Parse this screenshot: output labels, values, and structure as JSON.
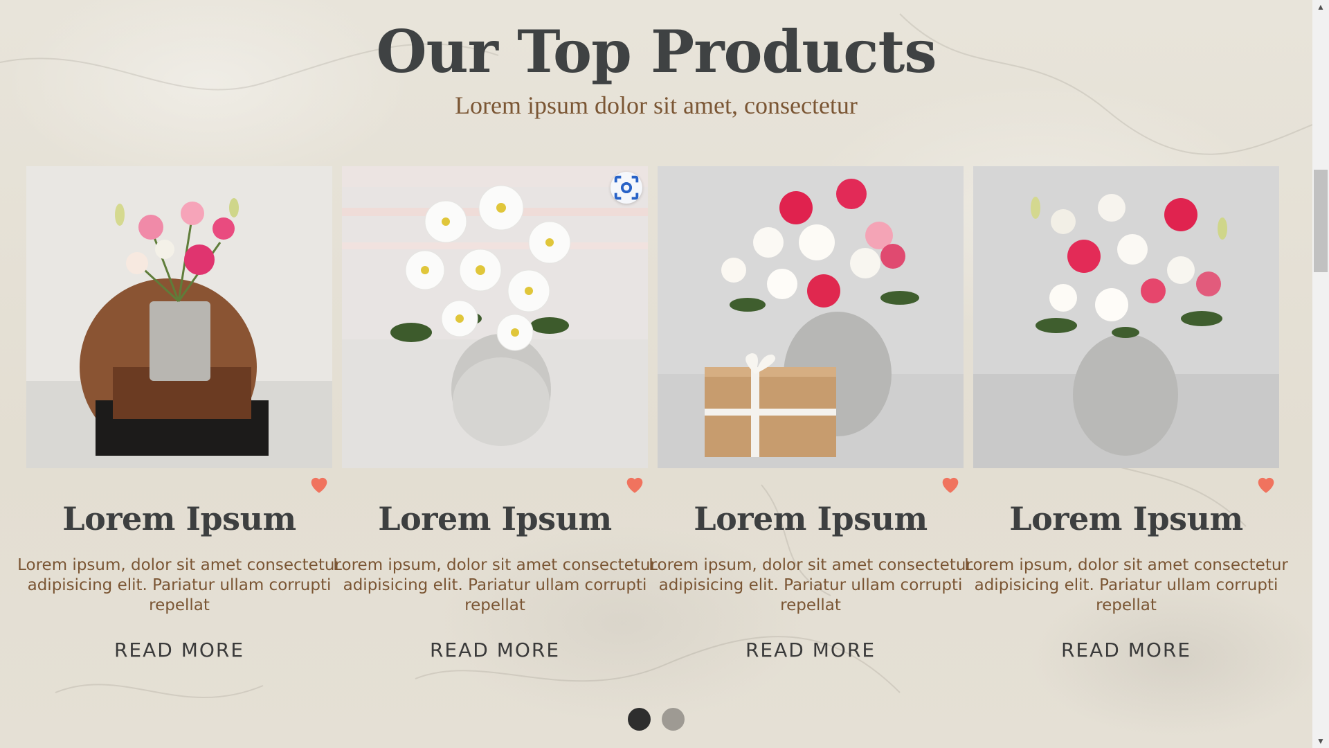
{
  "header": {
    "title": "Our Top Products",
    "subtitle": "Lorem ipsum dolor sit amet, consectetur"
  },
  "products": [
    {
      "title": "Lorem Ipsum",
      "description": "Lorem ipsum, dolor sit amet consectetur adipisicing elit. Pariatur ullam corrupti repellat",
      "cta": "READ MORE",
      "image": "pink-eustoma-in-concrete-vase-on-wooden-tray"
    },
    {
      "title": "Lorem Ipsum",
      "description": "Lorem ipsum, dolor sit amet consectetur adipisicing elit. Pariatur ullam corrupti repellat",
      "cta": "READ MORE",
      "image": "white-daisies-in-round-grey-vase"
    },
    {
      "title": "Lorem Ipsum",
      "description": "Lorem ipsum, dolor sit amet consectetur adipisicing elit. Pariatur ullam corrupti repellat",
      "cta": "READ MORE",
      "image": "roses-in-grey-vase-with-gift-box"
    },
    {
      "title": "Lorem Ipsum",
      "description": "Lorem ipsum, dolor sit amet consectetur adipisicing elit. Pariatur ullam corrupti repellat",
      "cta": "READ MORE",
      "image": "roses-and-eustoma-in-grey-vase"
    }
  ],
  "carousel": {
    "page_count": 2,
    "active_page": 1
  },
  "icons": {
    "favorite": "heart-icon",
    "visual_search": "lens-icon"
  },
  "colors": {
    "background": "#e6e1d6",
    "title": "#3f4243",
    "subtitle": "#7b5634",
    "heart": "#f0735e",
    "dot_active": "#2e2e2e",
    "dot_inactive": "#9e9a93"
  }
}
